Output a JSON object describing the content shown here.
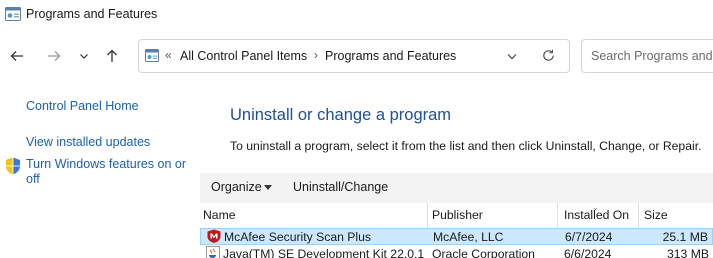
{
  "window": {
    "title": "Programs and Features"
  },
  "nav": {
    "back_icon": "back-arrow-icon",
    "forward_icon": "forward-arrow-icon",
    "recent_icon": "chevron-down-icon",
    "up_icon": "up-arrow-icon"
  },
  "address": {
    "overflow": "«",
    "segment1": "All Control Panel Items",
    "separator": "›",
    "segment2": "Programs and Features"
  },
  "search": {
    "placeholder": "Search Programs and Features"
  },
  "sidebar": {
    "items": [
      {
        "label": "Control Panel Home"
      },
      {
        "label": "View installed updates"
      },
      {
        "label": "Turn Windows features on or off",
        "icon": "shield-icon"
      }
    ]
  },
  "main": {
    "heading": "Uninstall or change a program",
    "instructions": "To uninstall a program, select it from the list and then click Uninstall, Change, or Repair."
  },
  "toolbar": {
    "organize": "Organize",
    "uninstall_change": "Uninstall/Change"
  },
  "table": {
    "columns": {
      "name": "Name",
      "publisher": "Publisher",
      "installed_on": "Installed On",
      "size": "Size"
    },
    "rows": [
      {
        "name": "McAfee Security Scan Plus",
        "publisher": "McAfee, LLC",
        "installed_on": "6/7/2024",
        "size": "25.1 MB",
        "selected": true
      },
      {
        "name": "Java(TM) SE Development Kit 22.0.1",
        "publisher": "Oracle Corporation",
        "installed_on": "6/6/2024",
        "size": "313 MB",
        "selected": false
      }
    ]
  },
  "colors": {
    "link": "#1a5fb4",
    "heading": "#1e4e9c",
    "selection": "#cce8ff",
    "selection_border": "#99d1ff"
  }
}
